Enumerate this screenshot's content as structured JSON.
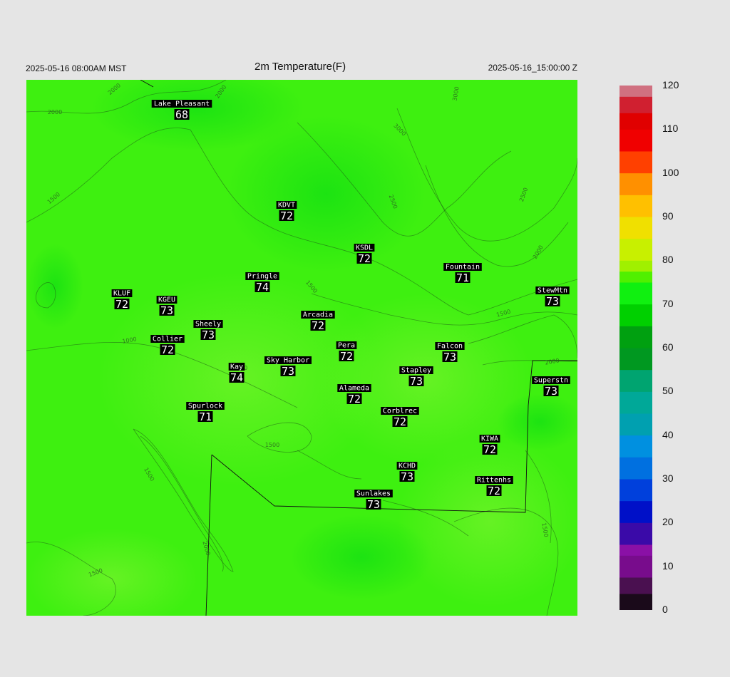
{
  "header": {
    "local_time": "2025-05-16 08:00AM MST",
    "title": "2m Temperature(F)",
    "utc_time": "2025-05-16_15:00:00 Z"
  },
  "colors": {
    "background": "#e5e5e5",
    "field_base": "#3cf00f",
    "field_warm": "#5cf020",
    "field_cool": "#22e418",
    "station_box": "#000000",
    "station_text": "#ffffff"
  },
  "colorbar": {
    "labels": [
      "120",
      "110",
      "100",
      "90",
      "80",
      "70",
      "60",
      "50",
      "40",
      "30",
      "20",
      "10",
      "0"
    ],
    "min": 0,
    "max": 120
  },
  "stations": [
    {
      "name": "Lake Pleasant",
      "value": "68"
    },
    {
      "name": "KDVT",
      "value": "72"
    },
    {
      "name": "KSDL",
      "value": "72"
    },
    {
      "name": "Fountain",
      "value": "71"
    },
    {
      "name": "Pringle",
      "value": "74"
    },
    {
      "name": "StewMtn",
      "value": "73"
    },
    {
      "name": "KLUF",
      "value": "72"
    },
    {
      "name": "KGEU",
      "value": "73"
    },
    {
      "name": "Arcadia",
      "value": "72"
    },
    {
      "name": "Sheely",
      "value": "73"
    },
    {
      "name": "Collier",
      "value": "72"
    },
    {
      "name": "Pera",
      "value": "72"
    },
    {
      "name": "Falcon",
      "value": "73"
    },
    {
      "name": "Sky Harbor",
      "value": "73"
    },
    {
      "name": "Kay",
      "value": "74"
    },
    {
      "name": "Stapley",
      "value": "73"
    },
    {
      "name": "Superstn",
      "value": "73"
    },
    {
      "name": "Alameda",
      "value": "72"
    },
    {
      "name": "Spurlock",
      "value": "71"
    },
    {
      "name": "Corblrec",
      "value": "72"
    },
    {
      "name": "KIWA",
      "value": "72"
    },
    {
      "name": "KCHD",
      "value": "73"
    },
    {
      "name": "Rittenhs",
      "value": "72"
    },
    {
      "name": "Sunlakes",
      "value": "73"
    }
  ],
  "contour_labels": [
    "2000",
    "2000",
    "2000",
    "3000",
    "3000",
    "2500",
    "2500",
    "1500",
    "2500",
    "2000",
    "1500",
    "1500",
    "1000",
    "1500",
    "2000",
    "1500",
    "1500",
    "2000",
    "1500",
    "1500"
  ]
}
